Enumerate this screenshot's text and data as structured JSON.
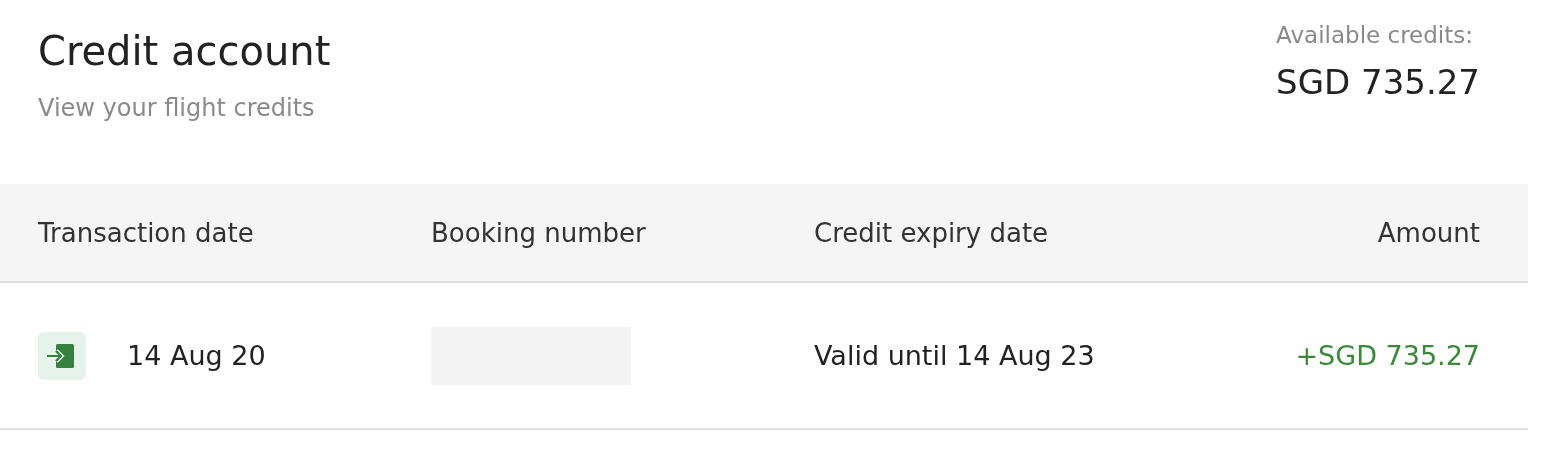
{
  "header": {
    "title": "Credit account",
    "subtitle": "View your flight credits"
  },
  "balance": {
    "label": "Available credits:",
    "amount": "SGD 735.27"
  },
  "table": {
    "columns": [
      "Transaction date",
      "Booking number",
      "Credit expiry date",
      "Amount"
    ],
    "rows": [
      {
        "kind": "credit",
        "date": "14 Aug 20",
        "booking_redacted": true,
        "expiry": "Valid until 14 Aug 23",
        "amount": "+SGD 735.27"
      }
    ]
  }
}
